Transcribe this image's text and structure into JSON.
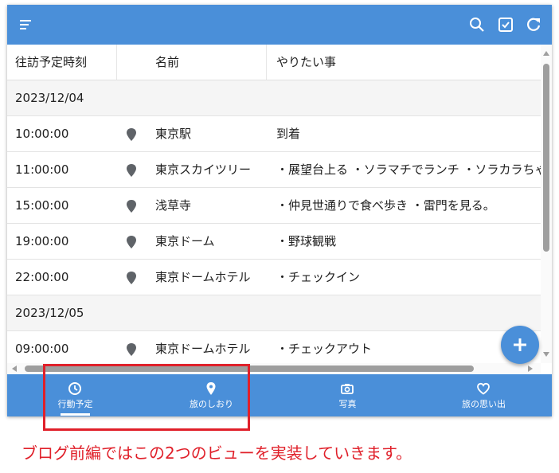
{
  "toolbar": {
    "menu_icon": "menu-icon",
    "search_icon": "search-icon",
    "checkbox_icon": "checkbox-icon",
    "refresh_icon": "refresh-icon"
  },
  "table": {
    "headers": {
      "time": "往訪予定時刻",
      "name": "名前",
      "todo": "やりたい事"
    },
    "groups": [
      {
        "date": "2023/12/04",
        "rows": [
          {
            "time": "10:00:00",
            "name": "東京駅",
            "todo": "到着"
          },
          {
            "time": "11:00:00",
            "name": "東京スカイツリー",
            "todo": "・展望台上る ・ソラマチでランチ ・ソラカラちゃん"
          },
          {
            "time": "15:00:00",
            "name": "浅草寺",
            "todo": "・仲見世通りで食べ歩き ・雷門を見る。"
          },
          {
            "time": "19:00:00",
            "name": "東京ドーム",
            "todo": "・野球観戦"
          },
          {
            "time": "22:00:00",
            "name": "東京ドームホテル",
            "todo": "・チェックイン"
          }
        ]
      },
      {
        "date": "2023/12/05",
        "rows": [
          {
            "time": "09:00:00",
            "name": "東京ドームホテル",
            "todo": "・チェックアウト"
          }
        ]
      }
    ]
  },
  "fab": {
    "icon": "plus-icon"
  },
  "bottom_nav": [
    {
      "label": "行動予定",
      "icon": "clock-icon",
      "selected": true
    },
    {
      "label": "旅のしおり",
      "icon": "map-pin-icon",
      "selected": false
    },
    {
      "label": "写真",
      "icon": "camera-icon",
      "selected": false
    },
    {
      "label": "旅の思い出",
      "icon": "heart-icon",
      "selected": false
    }
  ],
  "caption": "ブログ前編ではこの2つのビューを実装していきます。",
  "colors": {
    "primary": "#4a8fd9",
    "annotation_red": "#e0202a",
    "pin_gray": "#5f6368"
  }
}
